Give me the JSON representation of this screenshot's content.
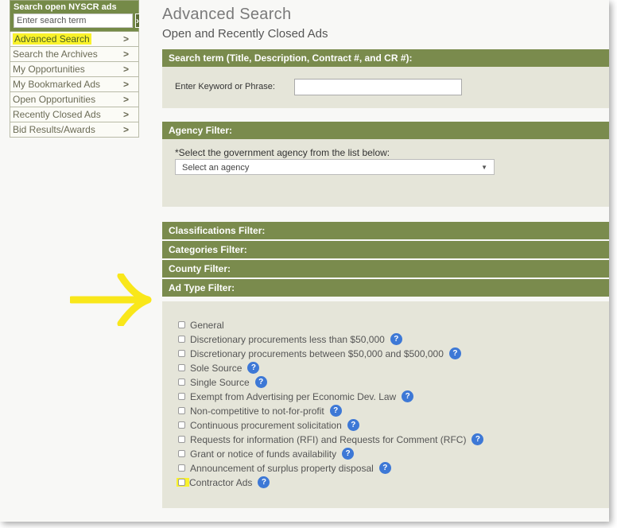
{
  "sidebar": {
    "search_title": "Search open NYSCR ads",
    "search_placeholder": "Enter search term",
    "search_go": "›",
    "items": [
      {
        "label": "Advanced Search"
      },
      {
        "label": "Search the Archives"
      },
      {
        "label": "My Opportunities"
      },
      {
        "label": "My Bookmarked Ads"
      },
      {
        "label": "Open Opportunities"
      },
      {
        "label": "Recently Closed Ads"
      },
      {
        "label": "Bid Results/Awards"
      }
    ]
  },
  "main": {
    "title": "Advanced Search",
    "subtitle": "Open and Recently Closed Ads",
    "search_term": {
      "header": "Search term (Title, Description, Contract #, and CR #):",
      "keyword_label": "Enter Keyword or Phrase:",
      "keyword_value": ""
    },
    "agency": {
      "header": "Agency Filter:",
      "label": "*Select the government agency from the list below:",
      "selected": "Select an agency"
    },
    "filters": {
      "classifications": "Classifications Filter:",
      "categories": "Categories Filter:",
      "county": "County Filter:",
      "ad_type": "Ad Type Filter:"
    },
    "ad_types": [
      {
        "label": "General"
      },
      {
        "label": "Discretionary procurements less than $50,000"
      },
      {
        "label": "Discretionary procurements between $50,000 and $500,000"
      },
      {
        "label": "Sole Source"
      },
      {
        "label": "Single Source"
      },
      {
        "label": "Exempt from Advertising per Economic Dev. Law"
      },
      {
        "label": "Non-competitive to not-for-profit"
      },
      {
        "label": "Continuous procurement solicitation"
      },
      {
        "label": "Requests for information (RFI) and Requests for Comment (RFC)"
      },
      {
        "label": "Grant or notice of funds availability"
      },
      {
        "label": "Announcement of surplus property disposal"
      },
      {
        "label": "Contractor Ads"
      }
    ]
  },
  "colors": {
    "band": "#7a8b4d",
    "highlight": "#f9f22b",
    "help_icon": "#3d78d6"
  }
}
